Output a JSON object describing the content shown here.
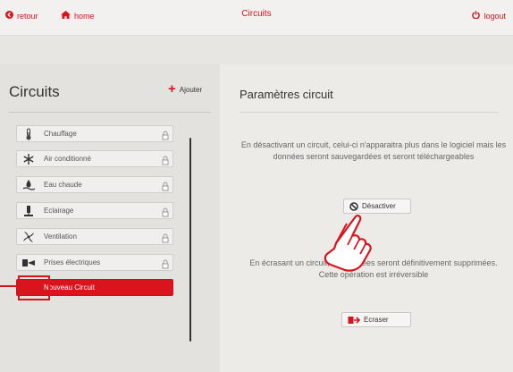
{
  "topbar": {
    "back_label": "retour",
    "home_label": "home",
    "title": "Circuits",
    "logout_label": "logout"
  },
  "left": {
    "title": "Circuits",
    "add_label": "Ajouter",
    "items": [
      {
        "label": "Chauffage",
        "icon": "thermometer-icon"
      },
      {
        "label": "Air conditionné",
        "icon": "snowflake-icon"
      },
      {
        "label": "Eau chaude",
        "icon": "water-drop-icon"
      },
      {
        "label": "Eclairage",
        "icon": "lamp-icon"
      },
      {
        "label": "Ventilation",
        "icon": "fan-icon"
      },
      {
        "label": "Prises électriques",
        "icon": "plug-icon"
      }
    ],
    "new_item_label": "Nouveau Circuit"
  },
  "right": {
    "title": "Paramètres circuit",
    "deactivate_text": "En désactivant un circuit, celui-ci n'apparaitra plus dans le logiciel mais les données seront sauvegardées et seront téléchargeables",
    "deactivate_button": "Désactiver",
    "overwrite_text": "En écrasant un circuit, les données seront définitivement supprimées. Cette opération est irréversible",
    "overwrite_button": "Ecraser"
  },
  "colors": {
    "accent": "#d9141c",
    "background": "#e7e6e3"
  }
}
